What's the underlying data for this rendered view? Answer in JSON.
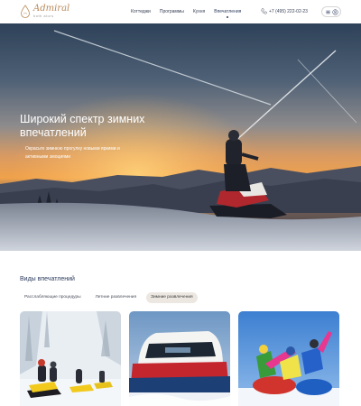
{
  "header": {
    "logo": {
      "title": "Admiral",
      "subtitle": "both alors"
    },
    "nav": [
      "Коттеджи",
      "Программы",
      "Кухня",
      "Впечатления"
    ],
    "active_nav": "Впечатления",
    "phone": "+7 (495) 222-02-23",
    "icons": [
      "menu-icon",
      "user-icon",
      "phone-icon"
    ]
  },
  "hero": {
    "title": "Широкий спектр зимних впечатлений",
    "subtitle": "Окрасьте зимнюю прогулку новыми яркими и активными эмоциями"
  },
  "experiences": {
    "title": "Виды впечатлений",
    "tabs": [
      {
        "label": "Расслабляющие процедуры",
        "active": false
      },
      {
        "label": "Летние развлечения",
        "active": false
      },
      {
        "label": "Зимние развлечения",
        "active": true
      }
    ]
  },
  "colors": {
    "accent": "#2c3b5e",
    "logo": "#b98a5a",
    "active_tab_bg": "#ece7e1"
  }
}
